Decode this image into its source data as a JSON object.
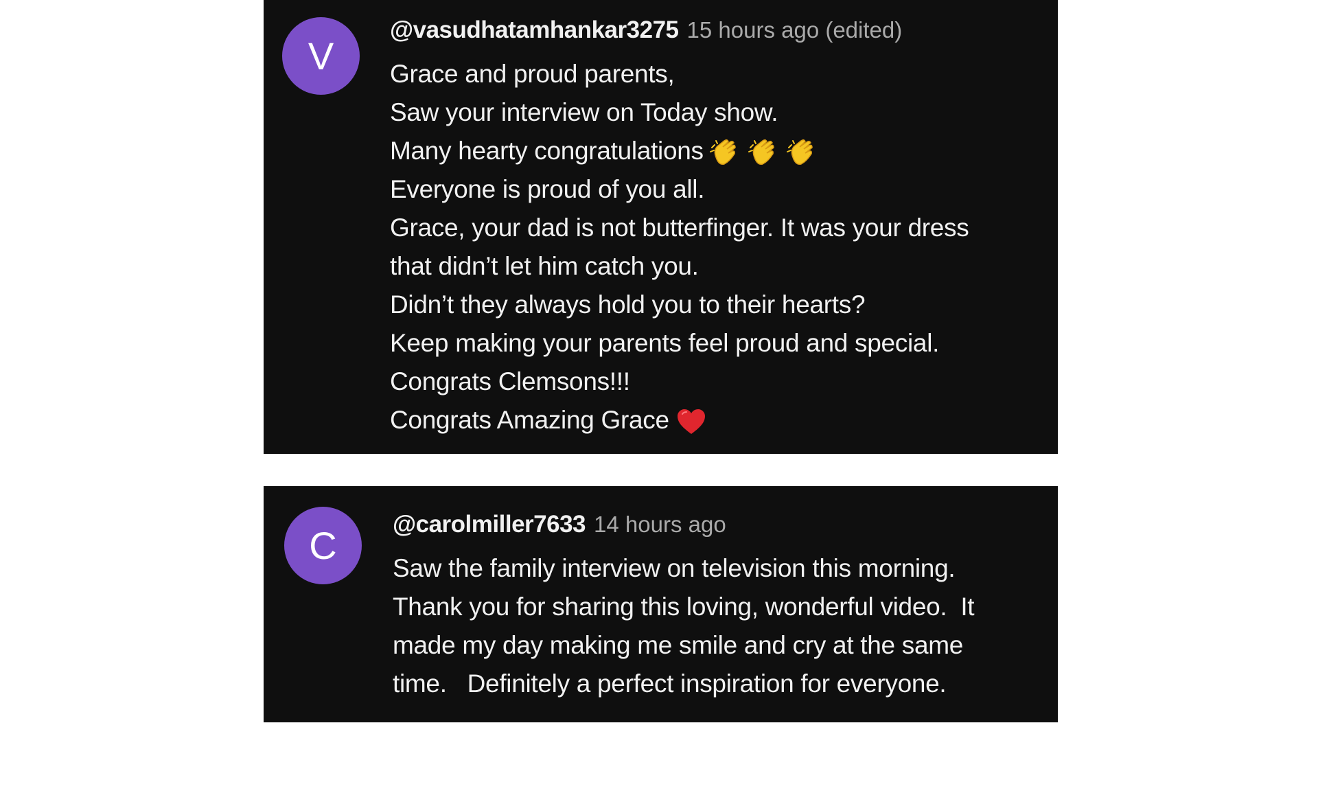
{
  "comments": [
    {
      "avatar_letter": "V",
      "avatar_color": "#7b4fc8",
      "username": "@vasudhatamhankar3275",
      "timestamp": "15 hours ago (edited)",
      "lines": [
        "Grace and proud parents,",
        "Saw your interview on Today show.",
        "Many hearty congratulations",
        "Everyone is proud of you all.",
        "Grace, your dad is not butterfinger. It was your dress",
        "that didn’t let him catch you.",
        "Didn’t they always hold you to their hearts?",
        "Keep making your parents feel proud and special.",
        "Congrats Clemsons!!!",
        "Congrats Amazing Grace"
      ],
      "emojis": {
        "line_3": [
          "clapping-hands-icon",
          "clapping-hands-icon",
          "clapping-hands-icon"
        ],
        "line_10": [
          "red-heart-icon"
        ]
      }
    },
    {
      "avatar_letter": "C",
      "avatar_color": "#7b4fc8",
      "username": "@carolmiller7633",
      "timestamp": "14 hours ago",
      "lines": [
        "Saw the family interview on television this morning.",
        "Thank you for sharing this loving, wonderful video.  It",
        "made my day making me smile and cry at the same",
        "time.   Definitely a perfect inspiration for everyone."
      ]
    }
  ],
  "colors": {
    "card_background": "#0f0f0f",
    "text_primary": "#f1f1f1",
    "text_secondary": "#aaaaaa",
    "page_background": "#ffffff"
  }
}
